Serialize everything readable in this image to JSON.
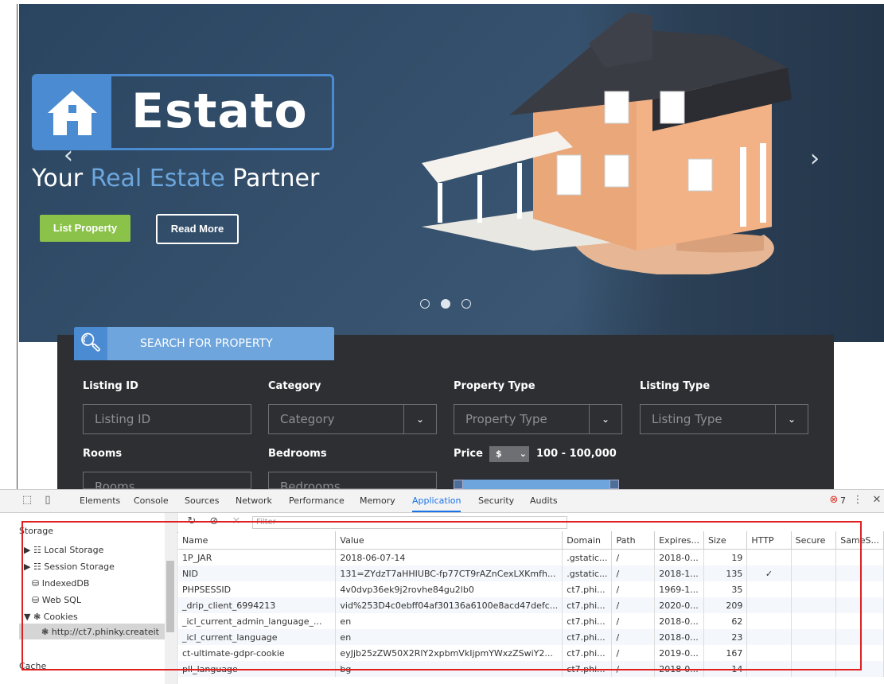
{
  "hero": {
    "logo_text": "Estato",
    "tagline_part1": "Your ",
    "tagline_part2": "Real Estate",
    "tagline_part3": " Partner",
    "list_property_label": "List Property",
    "read_more_label": "Read More",
    "prev_arrow": "‹",
    "next_arrow": "›",
    "slides": 3,
    "active_slide": 2
  },
  "search": {
    "tab_label": "SEARCH FOR PROPERTY",
    "fields": {
      "listing_id_label": "Listing ID",
      "listing_id_placeholder": "Listing ID",
      "category_label": "Category",
      "category_value": "Category",
      "property_type_label": "Property Type",
      "property_type_value": "Property Type",
      "listing_type_label": "Listing Type",
      "listing_type_value": "Listing Type",
      "rooms_label": "Rooms",
      "rooms_placeholder": "Rooms",
      "bedrooms_label": "Bedrooms",
      "bedrooms_placeholder": "Bedrooms",
      "price_label": "Price",
      "currency": "$",
      "price_range": "100 - 100,000"
    }
  },
  "devtools": {
    "tabs": [
      "Elements",
      "Console",
      "Sources",
      "Network",
      "Performance",
      "Memory",
      "Application",
      "Security",
      "Audits"
    ],
    "active_tab": "Application",
    "error_count": "7",
    "filter_placeholder": "Filter",
    "sidebar": {
      "storage_heading": "Storage",
      "local_storage": "Local Storage",
      "session_storage": "Session Storage",
      "indexeddb": "IndexedDB",
      "web_sql": "Web SQL",
      "cookies": "Cookies",
      "cookie_origin": "http://ct7.phinky.createit",
      "cache_heading": "Cache"
    },
    "columns": [
      "Name",
      "Value",
      "Domain",
      "Path",
      "Expires...",
      "Size",
      "HTTP",
      "Secure",
      "SameS..."
    ],
    "rows": [
      {
        "name": "1P_JAR",
        "value": "2018-06-07-14",
        "domain": ".gstatic...",
        "path": "/",
        "expires": "2018-0...",
        "size": "19",
        "http": "",
        "secure": "",
        "same": ""
      },
      {
        "name": "NID",
        "value": "131=ZYdzT7aHHIUBC-fp77CT9rAZnCexLXKmfh...",
        "domain": ".gstatic...",
        "path": "/",
        "expires": "2018-1...",
        "size": "135",
        "http": "✓",
        "secure": "",
        "same": ""
      },
      {
        "name": "PHPSESSID",
        "value": "4v0dvp36ek9j2rovhe84gu2lb0",
        "domain": "ct7.phi...",
        "path": "/",
        "expires": "1969-1...",
        "size": "35",
        "http": "",
        "secure": "",
        "same": ""
      },
      {
        "name": "_drip_client_6994213",
        "value": "vid%253D4c0ebff04af30136a6100e8acd47defc...",
        "domain": "ct7.phi...",
        "path": "/",
        "expires": "2020-0...",
        "size": "209",
        "http": "",
        "secure": "",
        "same": ""
      },
      {
        "name": "_icl_current_admin_language_...",
        "value": "en",
        "domain": "ct7.phi...",
        "path": "/",
        "expires": "2018-0...",
        "size": "62",
        "http": "",
        "secure": "",
        "same": ""
      },
      {
        "name": "_icl_current_language",
        "value": "en",
        "domain": "ct7.phi...",
        "path": "/",
        "expires": "2018-0...",
        "size": "23",
        "http": "",
        "secure": "",
        "same": ""
      },
      {
        "name": "ct-ultimate-gdpr-cookie",
        "value": "eyJjb25zZW50X2RlY2xpbmVkIjpmYWxzZSwiY2...",
        "domain": "ct7.phi...",
        "path": "/",
        "expires": "2019-0...",
        "size": "167",
        "http": "",
        "secure": "",
        "same": ""
      },
      {
        "name": "pll_language",
        "value": "bg",
        "domain": "ct7.phi...",
        "path": "/",
        "expires": "2018-0...",
        "size": "14",
        "http": "",
        "secure": "",
        "same": ""
      }
    ]
  }
}
